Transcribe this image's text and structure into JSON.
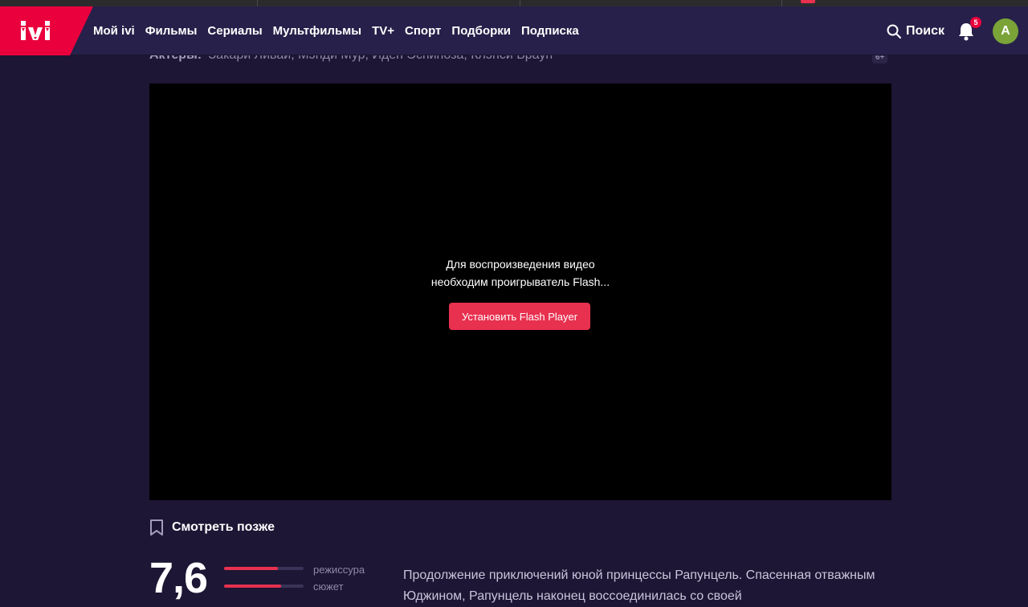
{
  "nav": {
    "items": [
      "Мой ivi",
      "Фильмы",
      "Сериалы",
      "Мультфильмы",
      "TV+",
      "Спорт",
      "Подборки",
      "Подписка"
    ]
  },
  "header": {
    "search_label": "Поиск",
    "notifications_count": "5",
    "avatar_letter": "A"
  },
  "movie": {
    "actors_label": "Актеры:",
    "actors": "Закари Ливай, Мэнди Мур, Иден Эспиноза, Клэнси Браун",
    "age_rating": "6+"
  },
  "player": {
    "message_line1": "Для воспроизведения видео",
    "message_line2": "необходим проигрыватель Flash...",
    "install_button": "Установить Flash Player"
  },
  "actions": {
    "watch_later": "Смотреть позже"
  },
  "rating": {
    "value": "7,6",
    "criteria": [
      {
        "label": "режиссура",
        "level": 0.68
      },
      {
        "label": "сюжет",
        "level": 0.72
      }
    ]
  },
  "description": {
    "text": "Продолжение приключений юной принцессы Рапунцель. Спасенная отважным Юджином, Рапунцель наконец воссоединилась со своей"
  },
  "colors": {
    "accent": "#e8304f",
    "brand": "#ea003d",
    "header_bg": "#27204a",
    "page_bg": "#1d1634"
  }
}
